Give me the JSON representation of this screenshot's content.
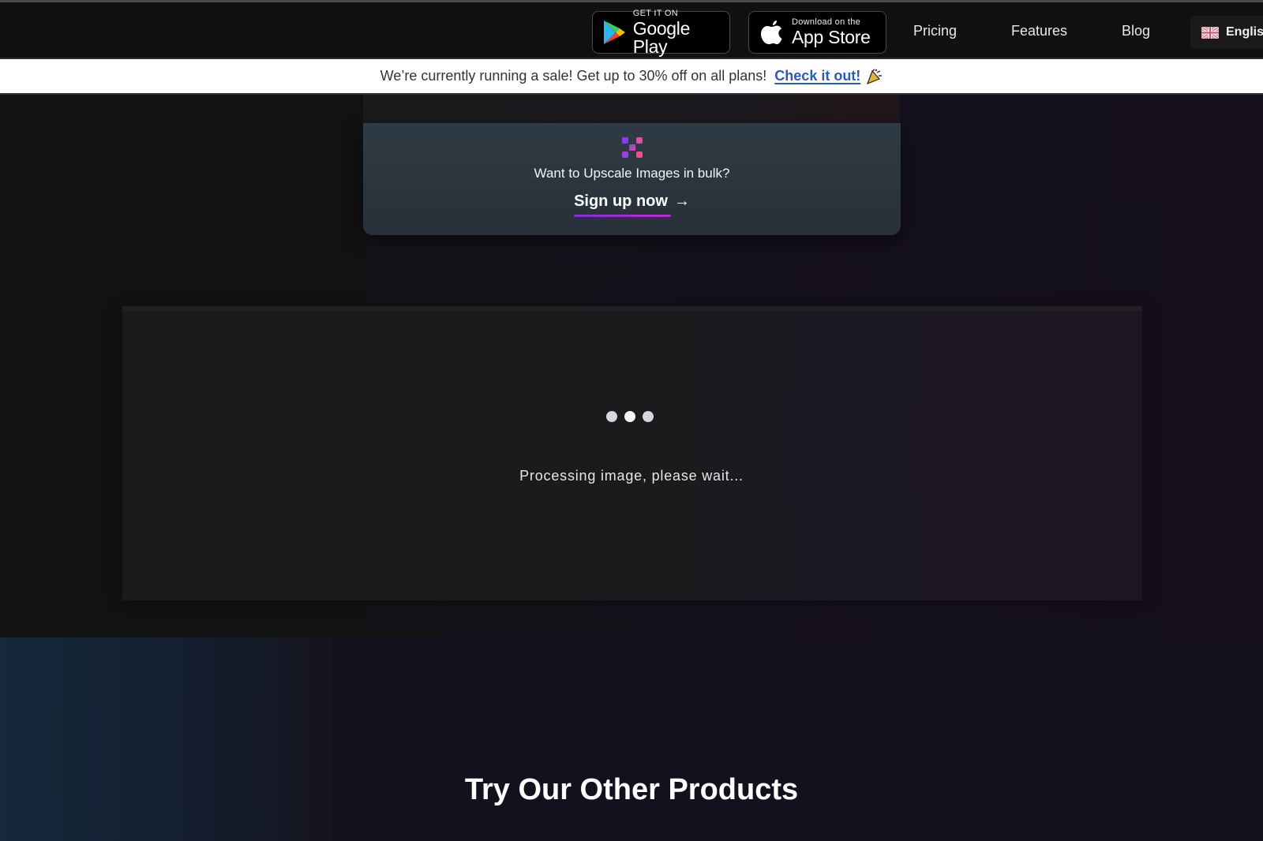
{
  "nav": {
    "google_play": {
      "small": "GET IT ON",
      "big": "Google Play",
      "icon": "google-play-icon"
    },
    "app_store": {
      "small": "Download on the",
      "big": "App Store",
      "icon": "apple-icon"
    },
    "links": [
      {
        "label": "Pricing"
      },
      {
        "label": "Features"
      },
      {
        "label": "Blog"
      }
    ],
    "language": {
      "label": "English",
      "icon": "uk-flag-icon"
    }
  },
  "banner": {
    "text": "We’re currently running a sale! Get up to 30% off on all plans!",
    "link_label": "Check it out!",
    "icon": "party-popper-icon",
    "link_color": "#2a5cb0"
  },
  "bulk_card": {
    "icon": "upscale-logo-icon",
    "title": "Want to Upscale Images in bulk?",
    "cta_label": "Sign up now",
    "cta_arrow": "→",
    "accent": "#a020f0"
  },
  "processing": {
    "message": "Processing image, please wait..."
  },
  "products_section": {
    "title": "Try Our Other Products"
  }
}
